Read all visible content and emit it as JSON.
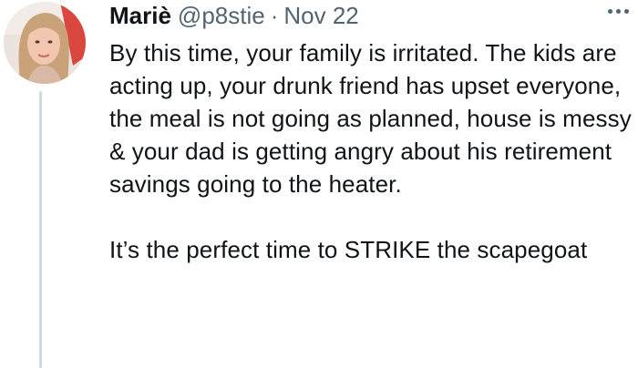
{
  "tweet": {
    "author_name": "Mariè",
    "handle": "@p8stie",
    "separator": "·",
    "date": "Nov 22",
    "text_paragraph_1": "By this time, your family is irritated. The kids are acting up, your drunk friend has upset everyone, the meal is not going as planned, house is messy & your dad is getting angry about his retirement savings going to the heater.",
    "text_paragraph_2": "It’s the perfect time to STRIKE the scapegoat",
    "more_icon": "more-horizontal-icon",
    "avatar_icon": "profile-avatar"
  },
  "colors": {
    "primary_text": "#0f1419",
    "secondary_text": "#536471",
    "thread_line": "#cfd9de"
  }
}
